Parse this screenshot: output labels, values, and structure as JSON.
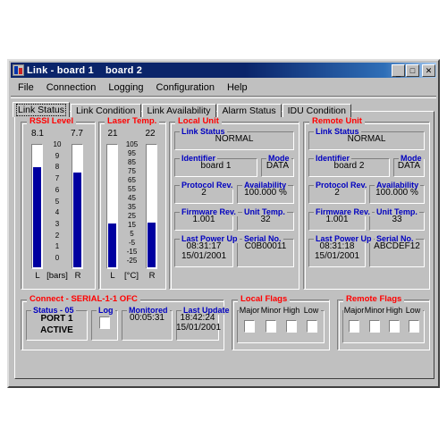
{
  "window": {
    "title": "Link - board 1    board 2",
    "buttons": {
      "minimize": "_",
      "maximize": "□",
      "close": "✕"
    }
  },
  "menu": {
    "items": [
      "File",
      "Connection",
      "Logging",
      "Configuration",
      "Help"
    ]
  },
  "tabs": {
    "items": [
      "Link Status",
      "Link Condition",
      "Link Availability",
      "Alarm Status",
      "IDU Condition"
    ],
    "active": "Link Status"
  },
  "rssi": {
    "caption": "RSSI Level",
    "left_value": "8.1",
    "right_value": "7.7",
    "left_label": "L",
    "right_label": "R",
    "unit_label": "[bars]",
    "scale": [
      "10",
      "9",
      "8",
      "7",
      "6",
      "5",
      "4",
      "3",
      "2",
      "1",
      "0"
    ],
    "min": 0,
    "max": 10,
    "left_fill": 8.1,
    "right_fill": 7.7
  },
  "laser": {
    "caption": "Laser Temp.",
    "left_value": "21",
    "right_value": "22",
    "left_label": "L",
    "right_label": "R",
    "unit_label": "[°C]",
    "scale": [
      "105",
      "95",
      "85",
      "75",
      "65",
      "55",
      "45",
      "35",
      "25",
      "15",
      "5",
      "-5",
      "-15",
      "-25"
    ],
    "min": -25,
    "max": 105,
    "left_fill": 21,
    "right_fill": 22
  },
  "local_unit": {
    "caption": "Local Unit",
    "link_status": {
      "label": "Link Status",
      "value": "NORMAL"
    },
    "identifier": {
      "label": "Identifier",
      "value": "board 1"
    },
    "mode": {
      "label": "Mode",
      "value": "DATA"
    },
    "protocol_rev": {
      "label": "Protocol Rev.",
      "value": "2"
    },
    "availability": {
      "label": "Availability",
      "value": "100.000 %"
    },
    "firmware_rev": {
      "label": "Firmware Rev.",
      "value": "1.001"
    },
    "unit_temp": {
      "label": "Unit Temp.",
      "value": "32"
    },
    "last_power_up": {
      "label": "Last Power Up",
      "time": "08:31:17",
      "date": "15/01/2001"
    },
    "serial_no": {
      "label": "Serial No.",
      "value": "C0B00011"
    }
  },
  "remote_unit": {
    "caption": "Remote Unit",
    "link_status": {
      "label": "Link Status",
      "value": "NORMAL"
    },
    "identifier": {
      "label": "Identifier",
      "value": "board 2"
    },
    "mode": {
      "label": "Mode",
      "value": "DATA"
    },
    "protocol_rev": {
      "label": "Protocol Rev.",
      "value": "2"
    },
    "availability": {
      "label": "Availability",
      "value": "100.000 %"
    },
    "firmware_rev": {
      "label": "Firmware Rev.",
      "value": "1.001"
    },
    "unit_temp": {
      "label": "Unit Temp.",
      "value": "33"
    },
    "last_power_up": {
      "label": "Last Power Up",
      "time": "08:31:18",
      "date": "15/01/2001"
    },
    "serial_no": {
      "label": "Serial No.",
      "value": "ABCDEF12"
    }
  },
  "connect": {
    "caption": "Connect - SERIAL-1-1 OFC",
    "status": {
      "label": "Status - 05",
      "line1": "PORT 1",
      "line2": "ACTIVE"
    },
    "log": {
      "label": "Log",
      "checked": false
    },
    "monitored": {
      "label": "Monitored",
      "value": "00:05:31"
    },
    "last_update": {
      "label": "Last Update",
      "time": "18:42:24",
      "date": "15/01/2001"
    }
  },
  "local_flags": {
    "caption": "Local Flags",
    "headers": [
      "Major",
      "Minor",
      "High",
      "Low"
    ],
    "checked": [
      false,
      false,
      false,
      false
    ]
  },
  "remote_flags": {
    "caption": "Remote Flags",
    "headers": [
      "Major",
      "Minor",
      "High",
      "Low"
    ],
    "checked": [
      false,
      false,
      false,
      false
    ]
  },
  "colors": {
    "title_bar": "#0a246a",
    "face": "#c0c0c0",
    "group_caption_red": "#ff0000",
    "field_caption_blue": "#0000c0",
    "bar_fill": "#0000a0"
  }
}
